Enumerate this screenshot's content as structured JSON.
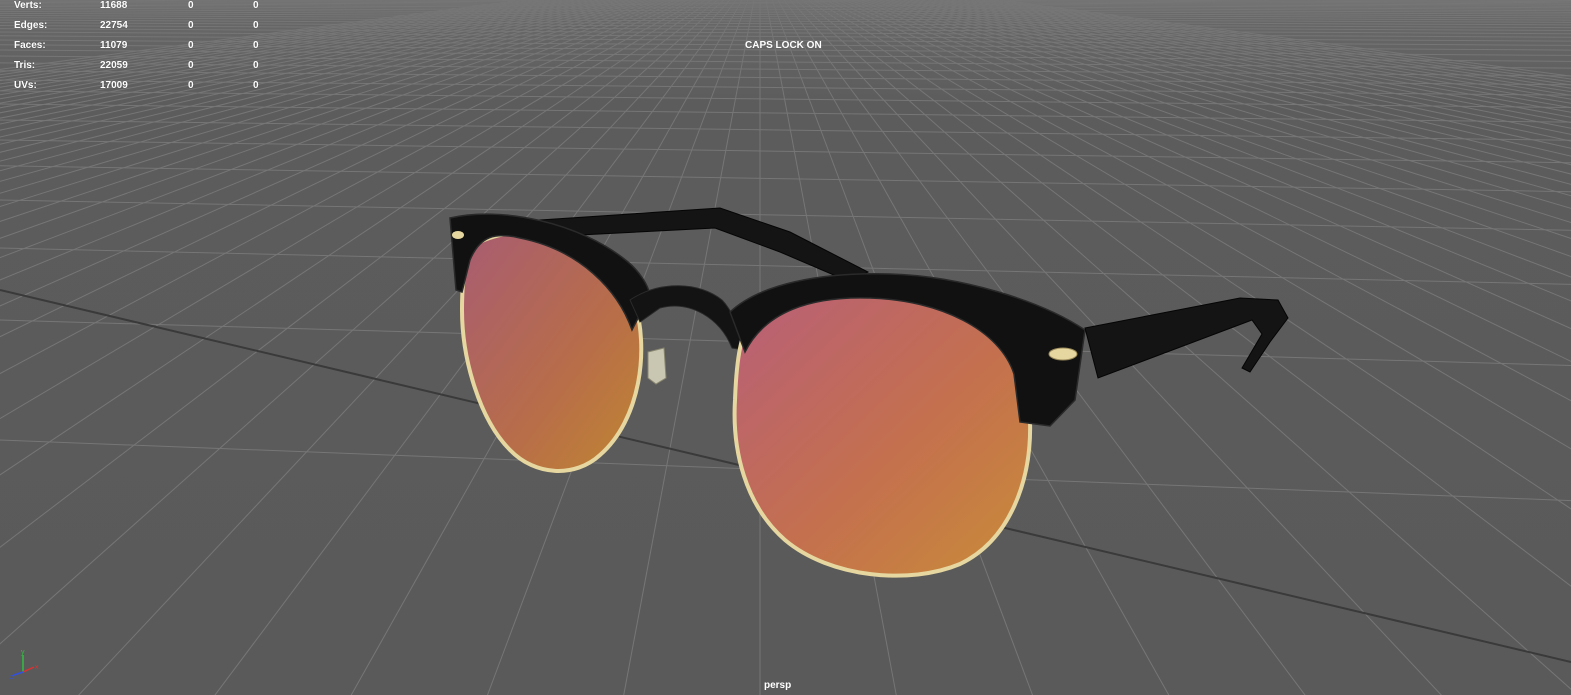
{
  "hud": {
    "rows": [
      {
        "label": "Verts:",
        "total": "11688",
        "selected": "0",
        "component": "0"
      },
      {
        "label": "Edges:",
        "total": "22754",
        "selected": "0",
        "component": "0"
      },
      {
        "label": "Faces:",
        "total": "11079",
        "selected": "0",
        "component": "0"
      },
      {
        "label": "Tris:",
        "total": "22059",
        "selected": "0",
        "component": "0"
      },
      {
        "label": "UVs:",
        "total": "17009",
        "selected": "0",
        "component": "0"
      }
    ]
  },
  "status": {
    "caps_lock": "CAPS LOCK ON"
  },
  "viewport": {
    "camera": "persp",
    "background_color": "#5d5d5d",
    "grid_color": "#6e6e6e",
    "grid_axis_color": "#3c3c3c"
  },
  "model": {
    "object": "sunglasses",
    "frame_color": "#121212",
    "rim_color": "#e6d7a0",
    "lens_color_top": "#b0607a",
    "lens_color_bottom": "#c98a3a"
  },
  "axis_gizmo": {
    "x_label": "x",
    "y_label": "y",
    "z_label": "z",
    "x_color": "#e03030",
    "y_color": "#30c040",
    "z_color": "#3050e0"
  }
}
